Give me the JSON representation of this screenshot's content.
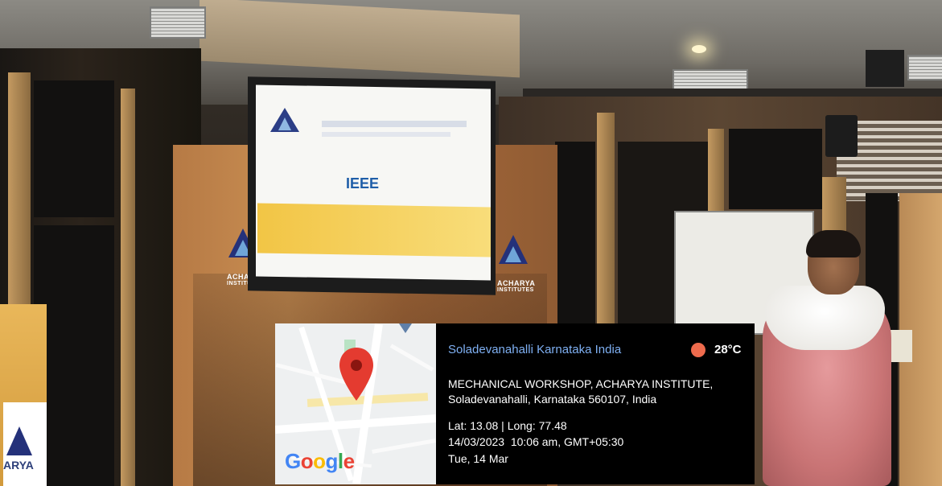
{
  "geotag": {
    "location_title": "Soladevanahalli Karnataka India",
    "temperature": "28°C",
    "address_line1": "MECHANICAL WORKSHOP, ACHARYA INSTITUTE,",
    "address_line2": "Soladevanahalli, Karnataka 560107, India",
    "coordinates": "Lat: 13.08 | Long: 77.48",
    "datetime": "14/03/2023  10:06 am, GMT+05:30",
    "day": "Tue, 14 Mar",
    "map_brand": "Google",
    "colors": {
      "title": "#7fb0f3",
      "temp_dot": "#ee6b4d",
      "pin": "#e43b30"
    }
  },
  "scene": {
    "screen_logo_text": "IEEE",
    "banner_logo_text_1": "ACHARYA",
    "banner_logo_text_2": "INSTITUTES",
    "left_sign_text": "ARYA"
  }
}
